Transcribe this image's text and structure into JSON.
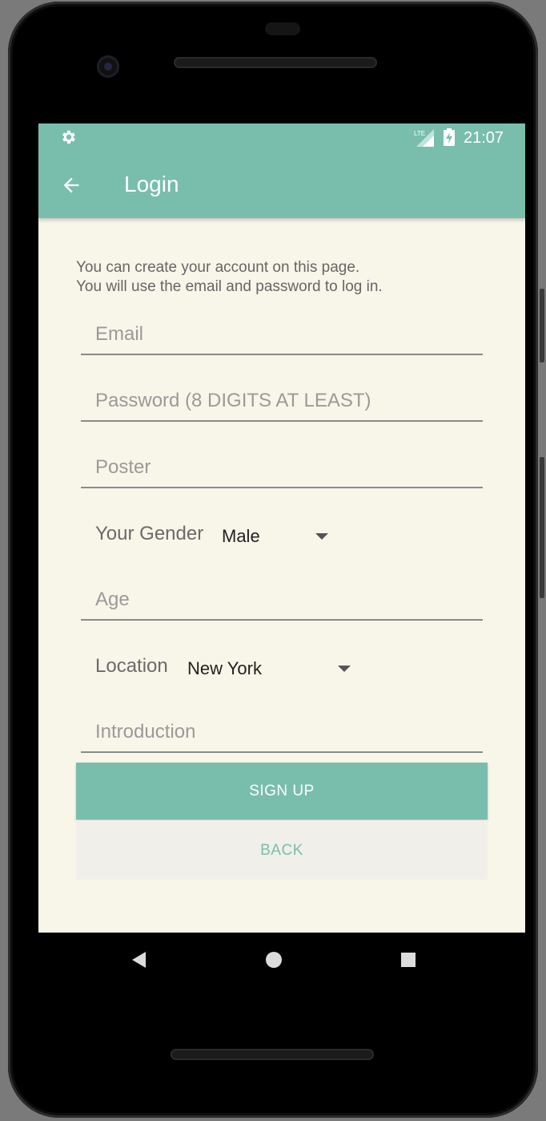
{
  "status_bar": {
    "settings_icon": "gear-icon",
    "network": "LTE",
    "battery_icon": "battery-charging-icon",
    "time": "21:07"
  },
  "app_bar": {
    "back_icon": "arrow-left-icon",
    "title": "Login"
  },
  "form": {
    "intro_line1": "You can create your account on this page.",
    "intro_line2": "You will use the email and password to log in.",
    "email_placeholder": "Email",
    "password_placeholder": "Password (8 DIGITS AT LEAST)",
    "poster_placeholder": "Poster",
    "gender_label": "Your Gender",
    "gender_value": "Male",
    "age_placeholder": "Age",
    "location_label": "Location",
    "location_value": "New York",
    "introduction_placeholder": "Introduction",
    "signup_label": "SIGN UP",
    "back_label": "BACK"
  },
  "nav_bar": {
    "back_icon": "triangle-back-icon",
    "home_icon": "circle-home-icon",
    "recents_icon": "square-recents-icon"
  },
  "colors": {
    "accent": "#79bead",
    "background": "#f8f6e9",
    "back_button_bg": "#f0efe9"
  }
}
